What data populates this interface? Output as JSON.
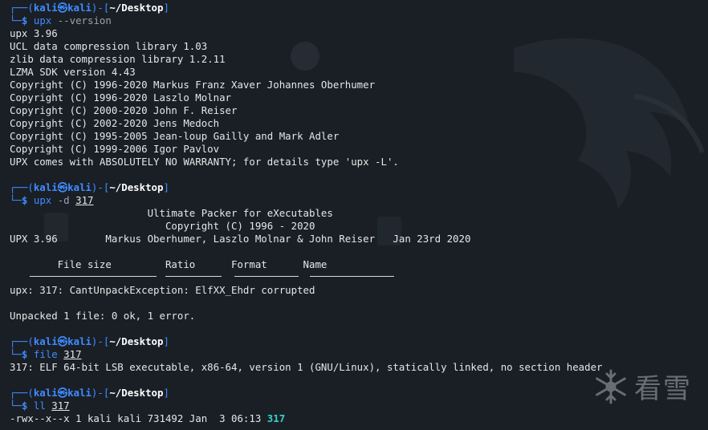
{
  "prompt": {
    "corner_top": "┌──(",
    "user": "kali",
    "at_glyph": "㉿",
    "host": "kali",
    "mid": ")-[",
    "dir": "~/Desktop",
    "end": "]",
    "corner_bottom": "└─",
    "dollar": "$"
  },
  "blocks": [
    {
      "command": "upx",
      "args": "--version",
      "output": [
        "upx 3.96",
        "UCL data compression library 1.03",
        "zlib data compression library 1.2.11",
        "LZMA SDK version 4.43",
        "Copyright (C) 1996-2020 Markus Franz Xaver Johannes Oberhumer",
        "Copyright (C) 1996-2020 Laszlo Molnar",
        "Copyright (C) 2000-2020 John F. Reiser",
        "Copyright (C) 2002-2020 Jens Medoch",
        "Copyright (C) 1995-2005 Jean-loup Gailly and Mark Adler",
        "Copyright (C) 1999-2006 Igor Pavlov",
        "UPX comes with ABSOLUTELY NO WARRANTY; for details type 'upx -L'."
      ]
    },
    {
      "command": "upx",
      "flag": "-d",
      "file": "317",
      "output": [
        "                       Ultimate Packer for eXecutables",
        "                          Copyright (C) 1996 - 2020",
        "UPX 3.96        Markus Oberhumer, Laszlo Molnar & John Reiser   Jan 23rd 2020",
        "",
        "        File size         Ratio      Format      Name",
        "",
        "upx: 317: CantUnpackException: ElfXX_Ehdr corrupted",
        "",
        "Unpacked 1 file: 0 ok, 1 error."
      ]
    },
    {
      "command": "file",
      "file": "317",
      "output": [
        "317: ELF 64-bit LSB executable, x86-64, version 1 (GNU/Linux), statically linked, no section header"
      ]
    },
    {
      "command": "ll",
      "file": "317",
      "listing_prefix": "-rwx--x--x 1 kali kali 731492 Jan  3 06:13 ",
      "listing_name": "317"
    }
  ],
  "watermark": {
    "text": "看雪",
    "icon": "snowflake-icon"
  },
  "colors": {
    "background": "#1a1f26",
    "prompt_blue": "#3f8cff",
    "executable_cyan": "#35d3c9",
    "text": "#e6e6e6"
  }
}
